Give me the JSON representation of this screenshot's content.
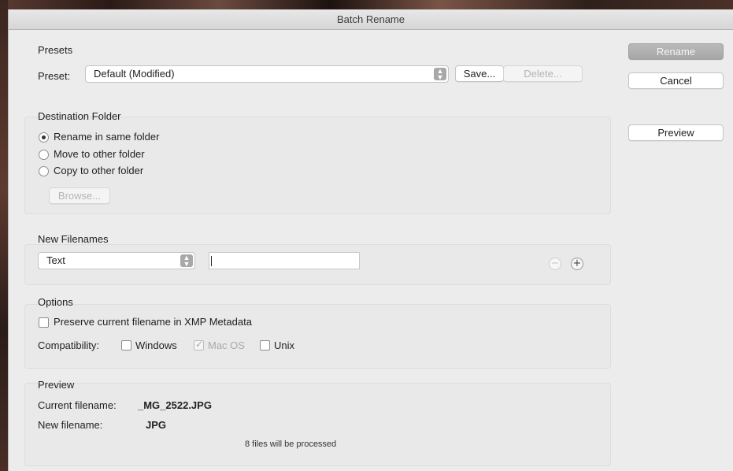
{
  "window": {
    "title": "Batch Rename"
  },
  "presets": {
    "section_title": "Presets",
    "preset_label": "Preset:",
    "preset_value": "Default (Modified)",
    "save_label": "Save...",
    "delete_label": "Delete..."
  },
  "side_buttons": {
    "rename_label": "Rename",
    "cancel_label": "Cancel",
    "preview_label": "Preview"
  },
  "destination": {
    "section_title": "Destination Folder",
    "options": [
      {
        "label": "Rename in same folder",
        "checked": true
      },
      {
        "label": "Move to other folder",
        "checked": false
      },
      {
        "label": "Copy to other folder",
        "checked": false
      }
    ],
    "browse_label": "Browse..."
  },
  "new_filenames": {
    "section_title": "New Filenames",
    "type_value": "Text",
    "text_value": ""
  },
  "options": {
    "section_title": "Options",
    "preserve_label": "Preserve current filename in XMP Metadata",
    "compat_label": "Compatibility:",
    "windows_label": "Windows",
    "macos_label": "Mac OS",
    "unix_label": "Unix"
  },
  "preview": {
    "section_title": "Preview",
    "current_label": "Current filename:",
    "current_value": "_MG_2522.JPG",
    "new_label": "New filename:",
    "new_value": "JPG",
    "status": "8 files will be processed"
  }
}
